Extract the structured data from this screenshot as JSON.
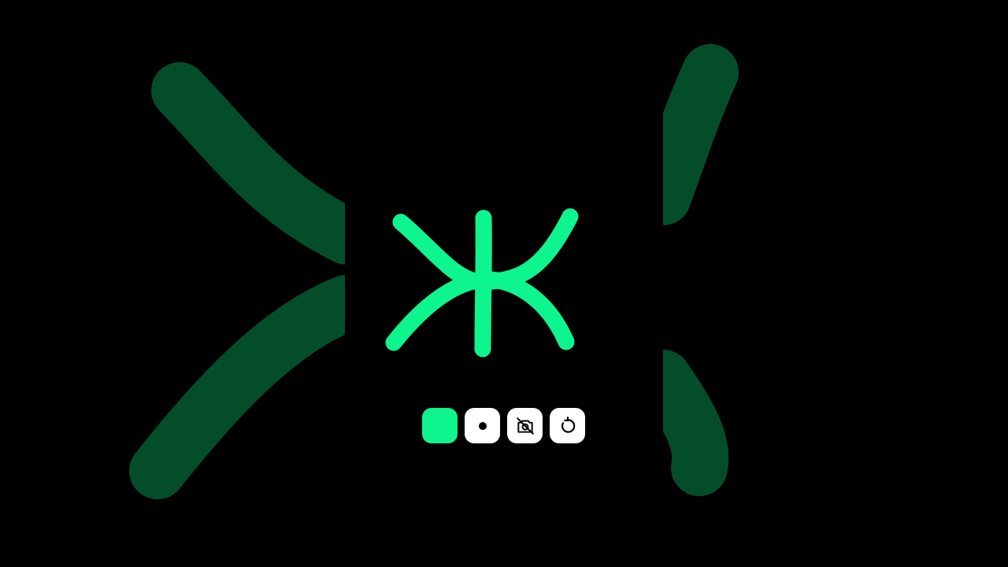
{
  "colors": {
    "background": "#000000",
    "stroke": "#0ef58f",
    "stroke_dim": "#044d2b",
    "button_bg": "#ffffff",
    "icon": "#000000"
  },
  "toolbar": {
    "buttons": [
      {
        "name": "color-swatch-button",
        "icon": "green-square-swatch",
        "color": "#0ef58f"
      },
      {
        "name": "brush-size-button",
        "icon": "dot-icon"
      },
      {
        "name": "camera-off-button",
        "icon": "camera-off-icon"
      },
      {
        "name": "reset-button",
        "icon": "rotate-ccw-icon"
      }
    ]
  }
}
